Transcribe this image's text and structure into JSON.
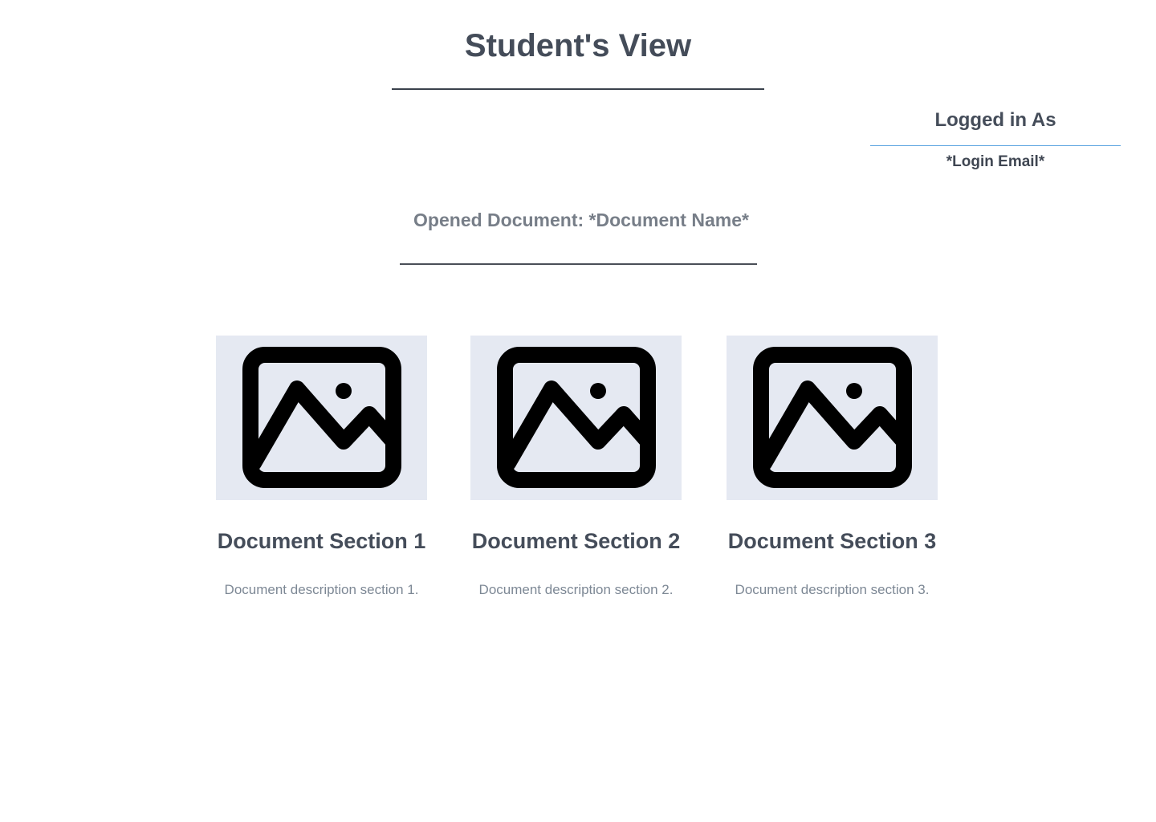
{
  "header": {
    "title": "Student's View"
  },
  "login": {
    "heading": "Logged in As",
    "email": "*Login Email*"
  },
  "document": {
    "heading": "Opened Document: *Document Name*"
  },
  "sections": [
    {
      "title": "Document Section 1",
      "description": "Document description section 1.",
      "icon": "image-icon"
    },
    {
      "title": "Document Section 2",
      "description": "Document description section 2.",
      "icon": "image-icon"
    },
    {
      "title": "Document Section 3",
      "description": "Document description section 3.",
      "icon": "image-icon"
    }
  ],
  "colors": {
    "image_placeholder_bg": "#e5e9f2",
    "login_divider": "#5aa3e0",
    "heading_text": "#454d5a",
    "muted_text": "#7d8895"
  }
}
